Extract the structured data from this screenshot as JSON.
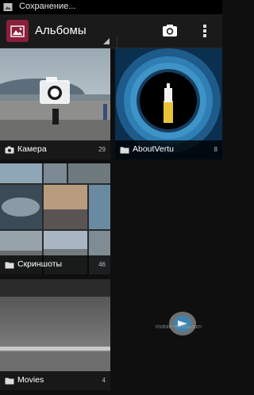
{
  "status": {
    "text": "Сохранение..."
  },
  "actionbar": {
    "title": "Альбомы",
    "camera_icon": "camera-icon",
    "menu_icon": "overflow-menu-icon"
  },
  "albums": [
    {
      "label": "Камера",
      "count": "29",
      "icon": "camera-icon"
    },
    {
      "label": "AboutVertu",
      "count": "8",
      "icon": "folder-icon"
    },
    {
      "label": "Скриншоты",
      "count": "46",
      "icon": "folder-icon"
    },
    {
      "label": "Movies",
      "count": "4",
      "icon": "folder-icon"
    }
  ],
  "watermark": {
    "text": "mobile-review.com"
  },
  "colors": {
    "app_icon": "#8a1f3b",
    "actionbar": "#1a1a1a",
    "background": "#0f0f0f"
  }
}
